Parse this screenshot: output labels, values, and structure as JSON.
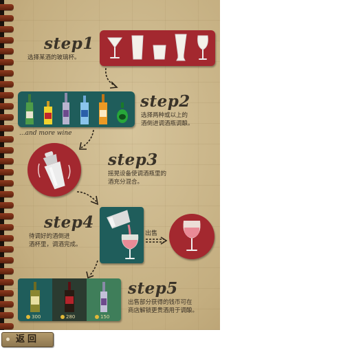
{
  "steps": [
    {
      "title": "step1",
      "desc": "选择某酒的玻璃杯。"
    },
    {
      "title": "step2",
      "desc": "选择两种或以上的\n酒倒进调酒瓶调酿。"
    },
    {
      "title": "step3",
      "desc": "摇晃设备使调酒瓶里的\n酒充分混合。"
    },
    {
      "title": "step4",
      "desc": "待调好的酒倒进\n酒杯里，调酒完成。"
    },
    {
      "title": "step5",
      "desc": "出售部分获得的钱币可在\n商店解锁更贵酒用于调酿。"
    }
  ],
  "wine_note": "...and more wine",
  "sell_label": "出售",
  "shop": {
    "prices": [
      "300",
      "280",
      "150"
    ]
  },
  "back_button": "返回",
  "colors": {
    "red": "#a3282f",
    "teal": "#1f5d5b",
    "paper": "#c9b58a"
  },
  "icons": [
    "martini-glass-icon",
    "highball-glass-icon",
    "tumbler-glass-icon",
    "pilsner-glass-icon",
    "wine-glass-icon",
    "shaker-icon",
    "bottle-icon",
    "coin-icon"
  ]
}
